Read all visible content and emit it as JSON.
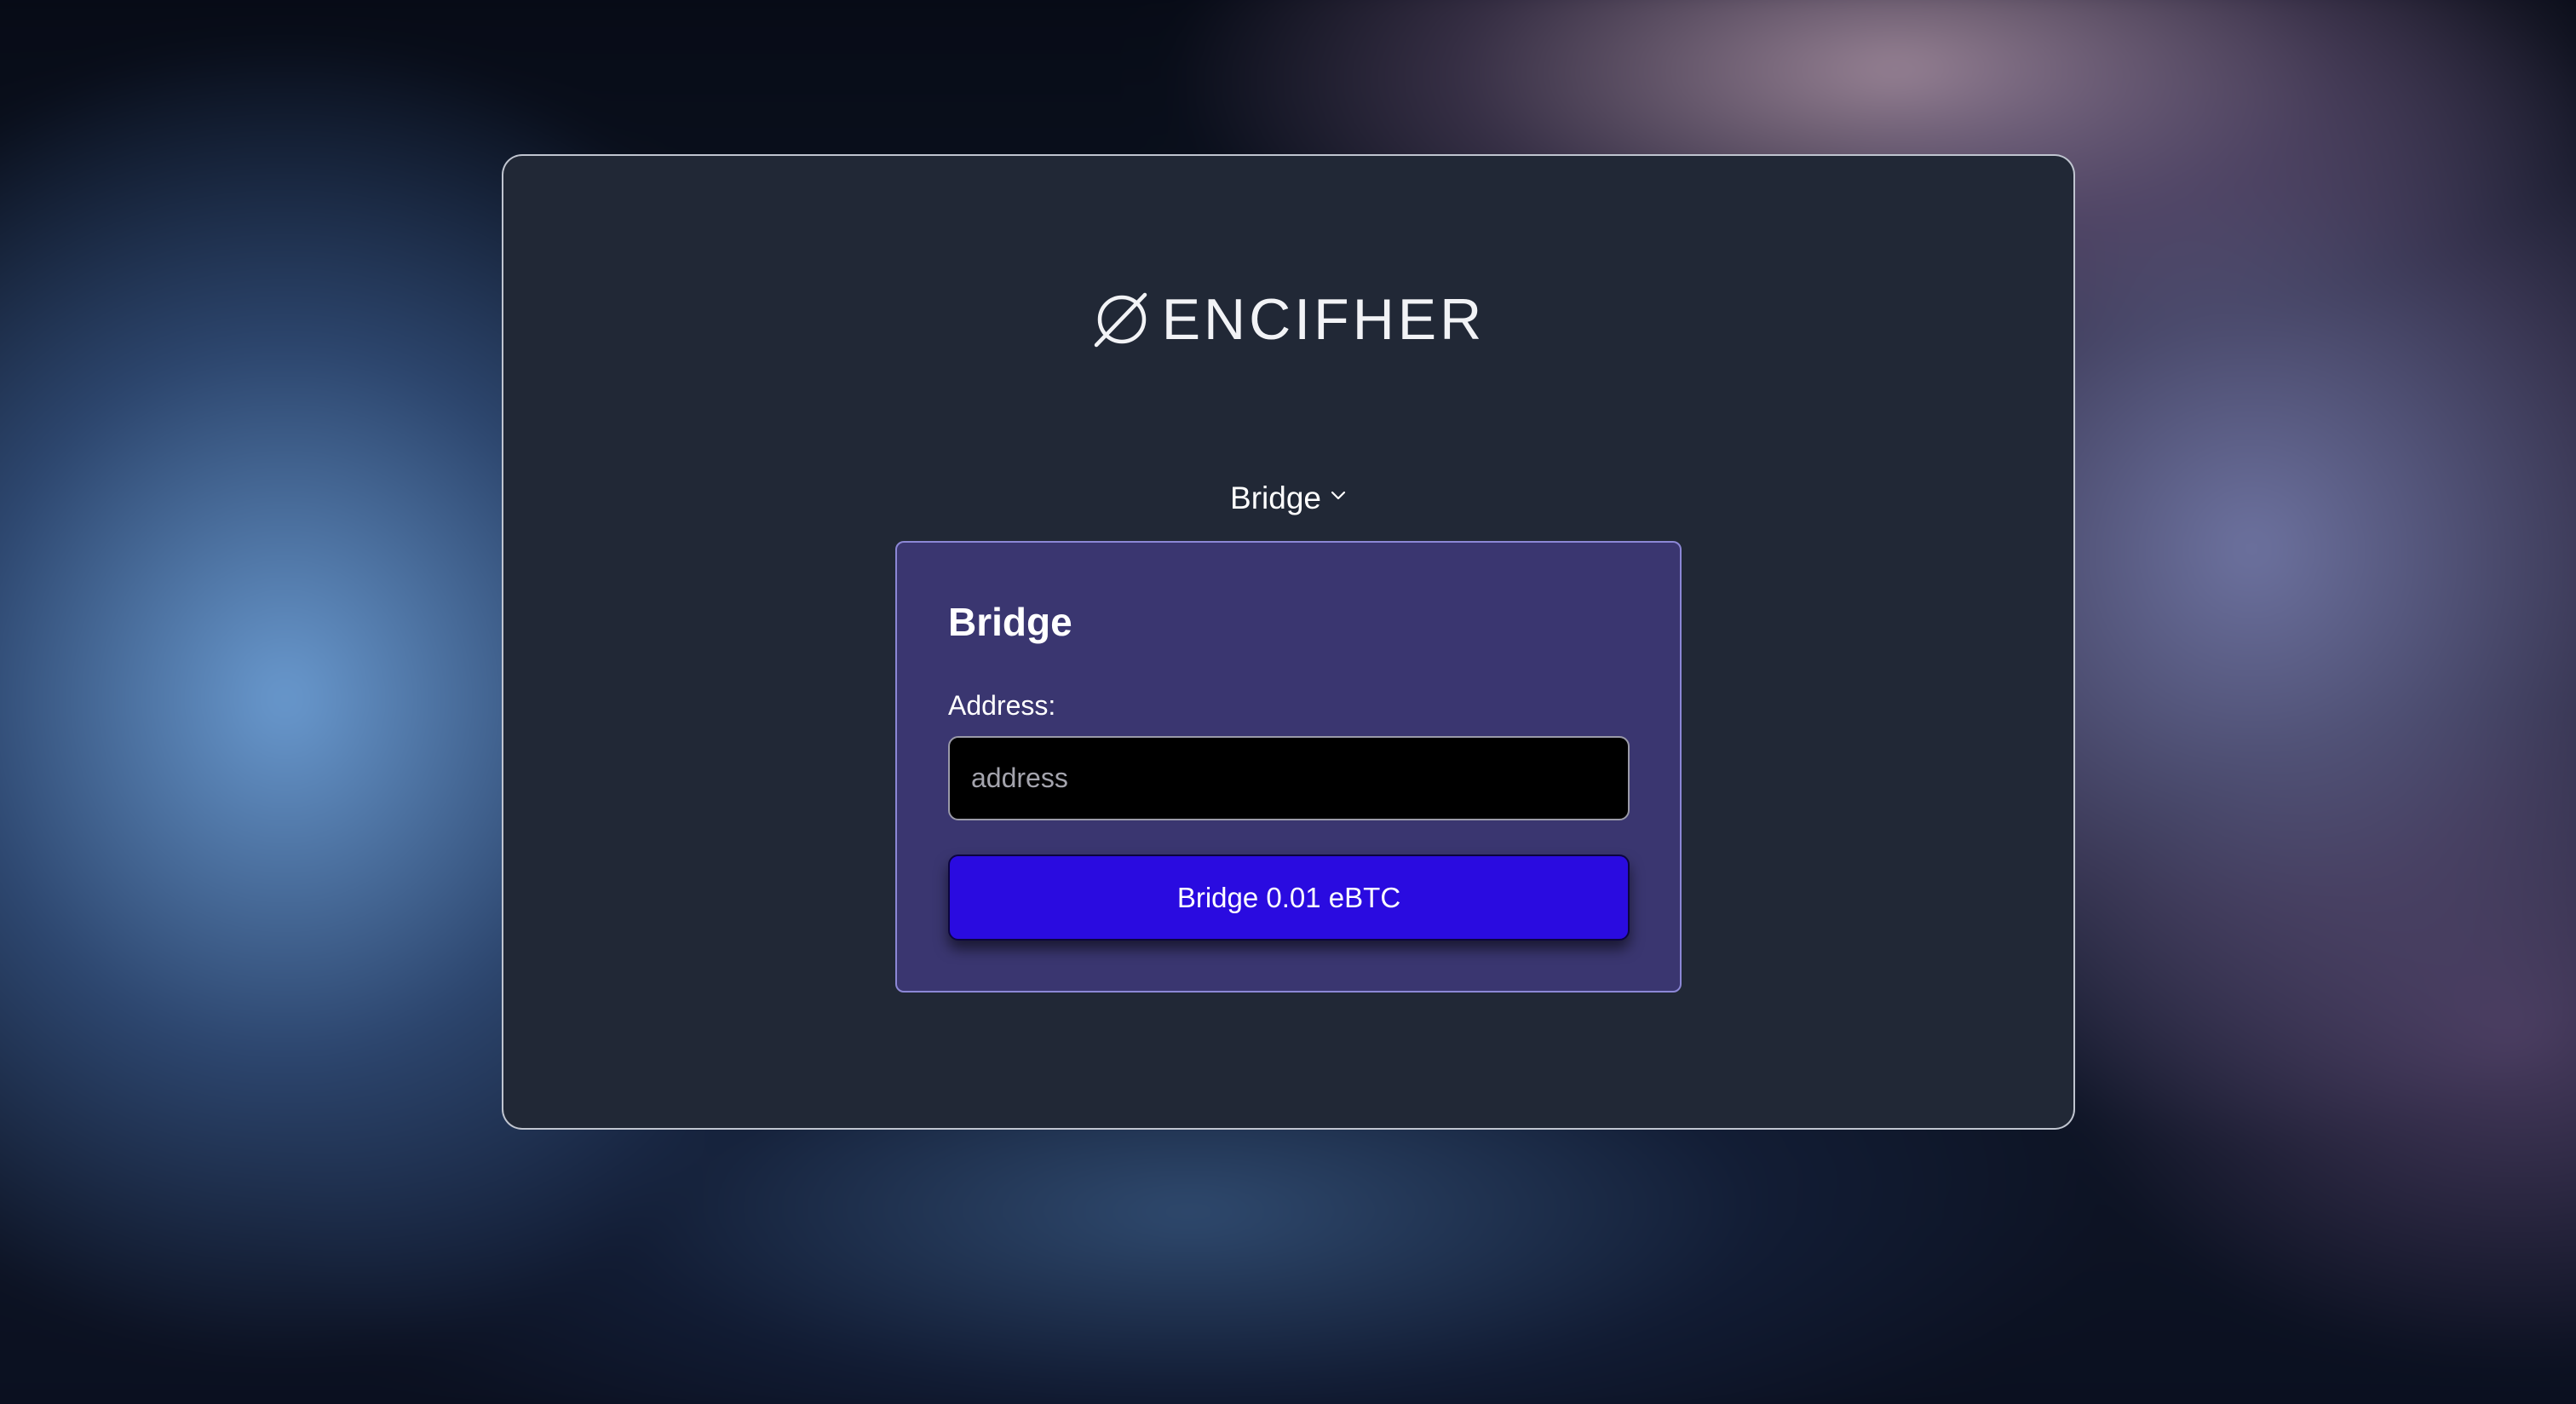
{
  "brand": {
    "name": "ENCIFHER",
    "icon": "slashed-circle-logo-icon"
  },
  "mode_selector": {
    "selected": "Bridge",
    "icon": "chevron-down-icon"
  },
  "bridge_form": {
    "title": "Bridge",
    "address_label": "Address:",
    "address_value": "",
    "address_placeholder": "address",
    "submit_label": "Bridge 0.01 eBTC"
  },
  "colors": {
    "card_background": "#212836",
    "panel_background": "#3a3670",
    "panel_border": "#8c87d6",
    "button_background": "#2a0be0",
    "input_background": "#000000"
  }
}
